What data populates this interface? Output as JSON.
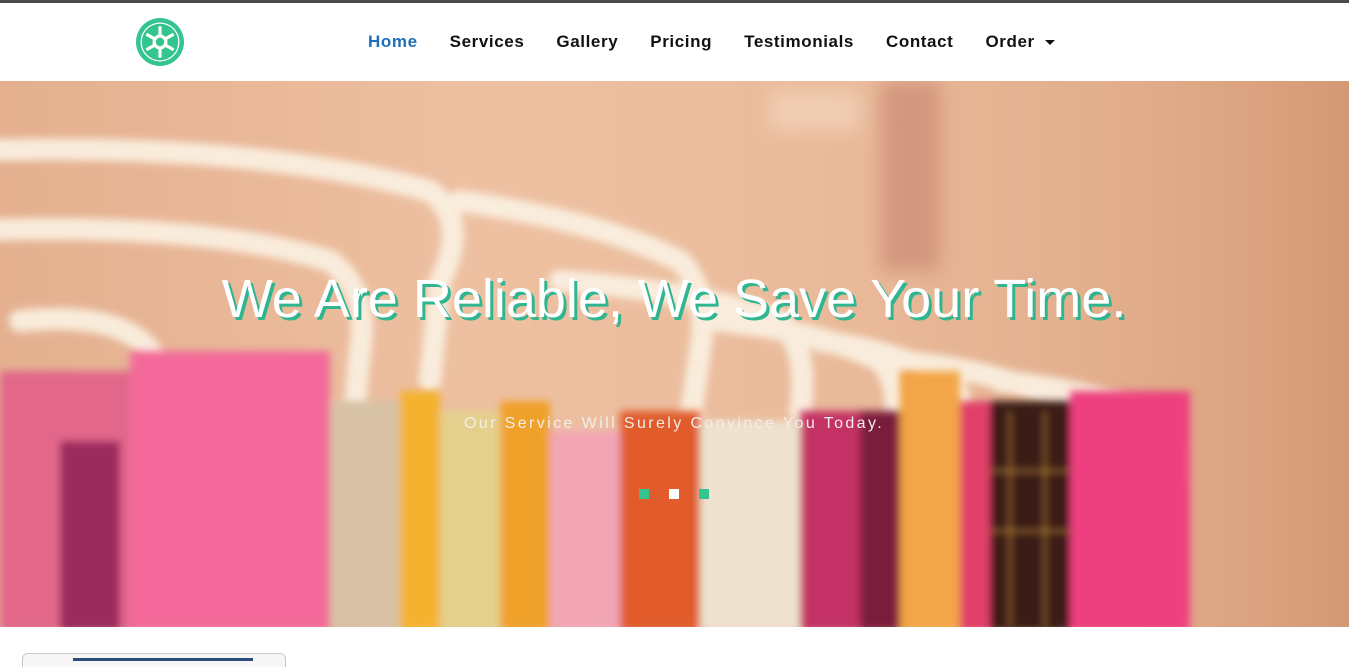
{
  "nav": {
    "logo_icon": "galactic-empire-cog-icon",
    "items": [
      {
        "label": "Home",
        "active": true
      },
      {
        "label": "Services",
        "active": false
      },
      {
        "label": "Gallery",
        "active": false
      },
      {
        "label": "Pricing",
        "active": false
      },
      {
        "label": "Testimonials",
        "active": false
      },
      {
        "label": "Contact",
        "active": false
      },
      {
        "label": "Order",
        "active": false,
        "dropdown": true
      }
    ]
  },
  "hero": {
    "title": "We Are Reliable, We Save Your Time.",
    "subtitle": "Our Service Will Surely Convince You Today.",
    "slides": 3,
    "active_slide": 2
  },
  "colors": {
    "accent": "#33c48f",
    "active_link": "#1e6fb8",
    "text": "#111111"
  }
}
